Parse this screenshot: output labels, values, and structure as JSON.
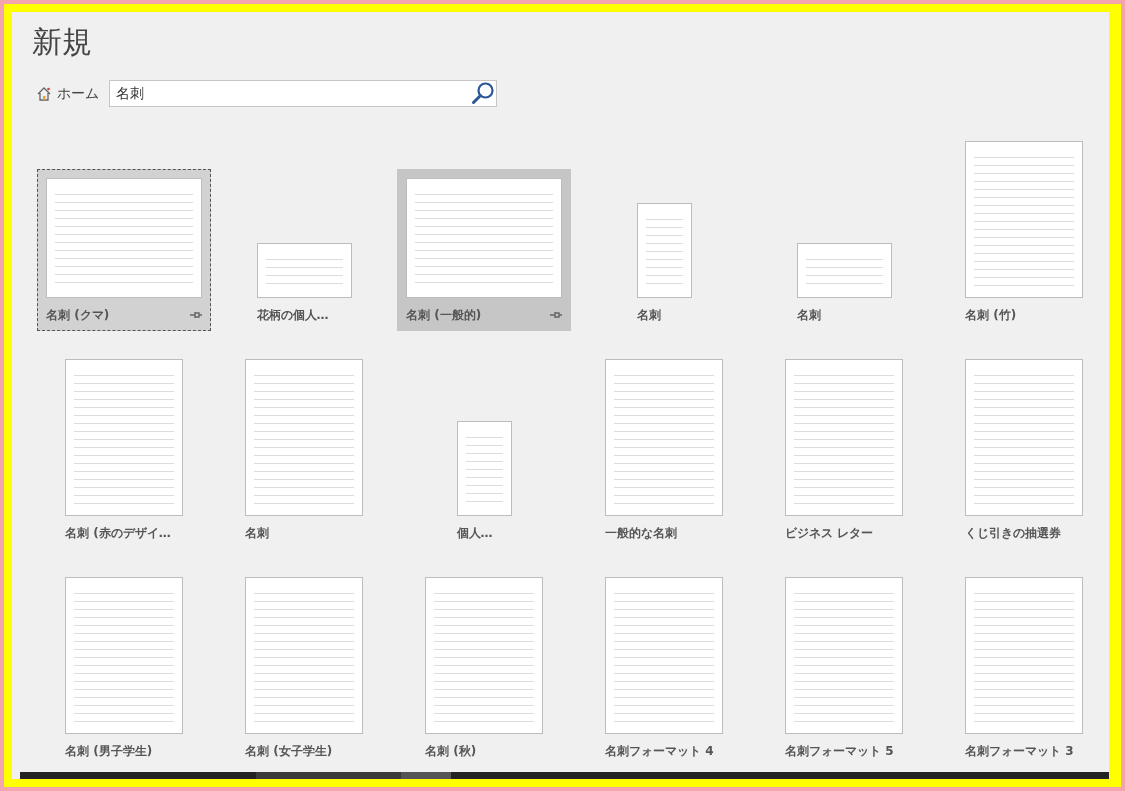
{
  "title": "新規",
  "home": {
    "label": "ホーム"
  },
  "search": {
    "value": "名刺"
  },
  "templates": [
    {
      "label": "名刺 (クマ)",
      "kind": "page-landscape",
      "selected": true,
      "hovered": false
    },
    {
      "label": "花柄の個人…",
      "kind": "card-landscape",
      "selected": false,
      "hovered": false
    },
    {
      "label": "名刺 (一般的)",
      "kind": "page-landscape",
      "selected": false,
      "hovered": true
    },
    {
      "label": "名刺",
      "kind": "card-portrait",
      "selected": false,
      "hovered": false
    },
    {
      "label": "名刺",
      "kind": "card-landscape",
      "selected": false,
      "hovered": false
    },
    {
      "label": "名刺 (竹)",
      "kind": "page-portrait",
      "selected": false,
      "hovered": false
    },
    {
      "label": "名刺 (赤のデザイ…",
      "kind": "page-portrait",
      "selected": false,
      "hovered": false
    },
    {
      "label": "名刺",
      "kind": "page-portrait",
      "selected": false,
      "hovered": false
    },
    {
      "label": "個人…",
      "kind": "card-portrait",
      "selected": false,
      "hovered": false
    },
    {
      "label": "一般的な名刺",
      "kind": "page-portrait",
      "selected": false,
      "hovered": false
    },
    {
      "label": "ビジネス レター",
      "kind": "page-portrait",
      "selected": false,
      "hovered": false
    },
    {
      "label": "くじ引きの抽選券",
      "kind": "page-portrait",
      "selected": false,
      "hovered": false
    },
    {
      "label": "名刺 (男子学生)",
      "kind": "page-portrait",
      "selected": false,
      "hovered": false
    },
    {
      "label": "名刺 (女子学生)",
      "kind": "page-portrait",
      "selected": false,
      "hovered": false
    },
    {
      "label": "名刺 (秋)",
      "kind": "page-portrait",
      "selected": false,
      "hovered": false
    },
    {
      "label": "名刺フォーマット 4",
      "kind": "page-portrait",
      "selected": false,
      "hovered": false
    },
    {
      "label": "名刺フォーマット 5",
      "kind": "page-portrait",
      "selected": false,
      "hovered": false
    },
    {
      "label": "名刺フォーマット 3",
      "kind": "page-portrait",
      "selected": false,
      "hovered": false
    }
  ]
}
